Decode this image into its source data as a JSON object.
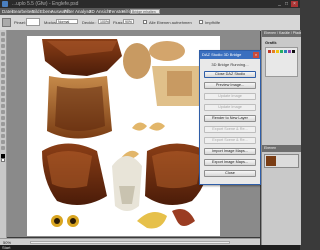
{
  "window": {
    "title": "...uplo 5.5 (Gfw) - Englefe.psd"
  },
  "menubar": {
    "items": [
      "Datei",
      "Bearbeiten",
      "Bild",
      "Ebene",
      "Auswahl",
      "Filter",
      "Analyse",
      "3D",
      "Ansicht",
      "Fenster",
      "Hilfe"
    ],
    "search_placeholder": "Bridge erhalten"
  },
  "options": {
    "pinsel_label": "Pinsel:",
    "modus_label": "Modus:",
    "modus_value": "Normal",
    "deckkraft_label": "Deckkr.:",
    "deckkraft_value": "100%",
    "fluss_label": "Fluss:",
    "fluss_value": "90%",
    "checkbox_label": "Alle Ebenen aufnehmen",
    "checkbox2_label": "Impfhilfe"
  },
  "statusbar": {
    "zoom": "50%"
  },
  "right_panel": {
    "head1": "Ebenen / Kanäle / Pfade",
    "tab1": "Grafik",
    "head2": "Ebenen",
    "swatch_colors": [
      "#c0392b",
      "#e67e22",
      "#f1c40f",
      "#27ae60",
      "#2980b9",
      "#8e44ad",
      "#111111",
      "#ffffff"
    ]
  },
  "bridge": {
    "title": "DAZ Studio 3D Bridge",
    "status": "3D Bridge Running...",
    "buttons": [
      {
        "label": "Close DAZ Studio",
        "enabled": true
      },
      {
        "label": "Preview Image...",
        "enabled": true
      },
      {
        "label": "Update Image",
        "enabled": false
      },
      {
        "label": "Update Image",
        "enabled": false
      },
      {
        "label": "Render to New Layer",
        "enabled": true
      },
      {
        "label": "Export Scene & Re...",
        "enabled": false
      },
      {
        "label": "Export Scene & Re...",
        "enabled": false
      },
      {
        "label": "Import Image Maps...",
        "enabled": true
      },
      {
        "label": "Export Image Maps...",
        "enabled": true
      },
      {
        "label": "Close",
        "enabled": true
      }
    ]
  },
  "taskbar": {
    "start_label": "Start"
  },
  "colors": {
    "accent": "#3a6fbf",
    "feather_dark": "#6b2c12",
    "feather_mid": "#a0521d",
    "feather_light": "#d7b98a"
  }
}
